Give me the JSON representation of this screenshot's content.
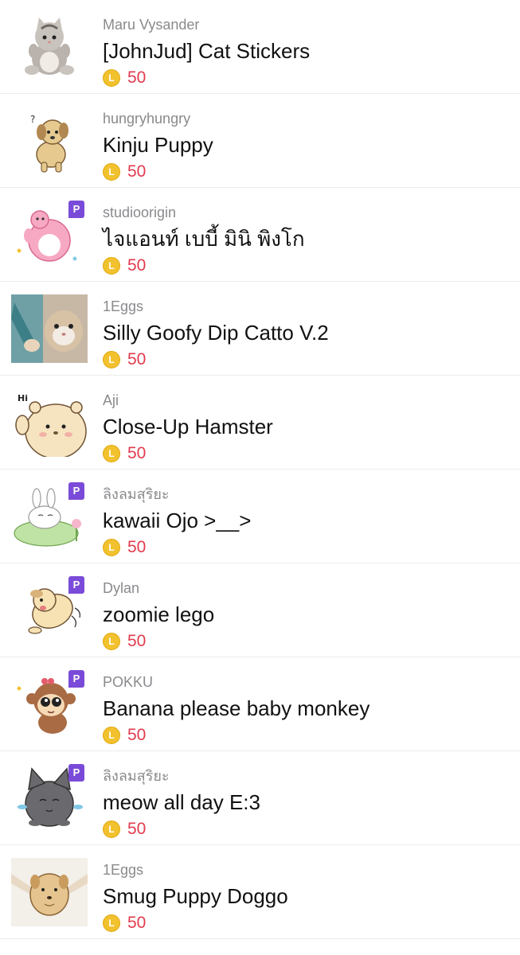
{
  "items": [
    {
      "author": "Maru Vysander",
      "title": "[JohnJud] Cat Stickers",
      "price": "50",
      "premium": false,
      "icon": "cat-sticker-icon"
    },
    {
      "author": "hungryhungry",
      "title": "Kinju Puppy",
      "price": "50",
      "premium": false,
      "icon": "puppy-sticker-icon"
    },
    {
      "author": "studioorigin",
      "title": "ไจแอนท์ เบบี้ มินิ พิงโก",
      "price": "50",
      "premium": true,
      "icon": "pink-creature-sticker-icon"
    },
    {
      "author": "1Eggs",
      "title": "Silly Goofy Dip Catto V.2",
      "price": "50",
      "premium": false,
      "icon": "photo-cat-sticker-icon"
    },
    {
      "author": "Aji",
      "title": "Close-Up Hamster",
      "price": "50",
      "premium": false,
      "icon": "hamster-sticker-icon",
      "icon_text": "Hi"
    },
    {
      "author": "ลิงลมสุริยะ",
      "title": "kawaii Ojo >__>",
      "price": "50",
      "premium": true,
      "icon": "lilypad-bunny-sticker-icon"
    },
    {
      "author": "Dylan",
      "title": "zoomie lego",
      "price": "50",
      "premium": true,
      "icon": "running-dog-sticker-icon"
    },
    {
      "author": "POKKU",
      "title": "Banana please baby monkey",
      "price": "50",
      "premium": true,
      "icon": "monkey-sticker-icon"
    },
    {
      "author": "ลิงลมสุริยะ",
      "title": "meow all day E:3",
      "price": "50",
      "premium": true,
      "icon": "crying-cat-sticker-icon"
    },
    {
      "author": "1Eggs",
      "title": "Smug Puppy Doggo",
      "price": "50",
      "premium": false,
      "icon": "smug-puppy-sticker-icon"
    }
  ],
  "coin_glyph": "L",
  "premium_badge": "P",
  "colors": {
    "price": "#e23b4e",
    "coin": "#f2c12e",
    "premium_badge": "#7a4bd8",
    "author": "#8a8a8e"
  }
}
